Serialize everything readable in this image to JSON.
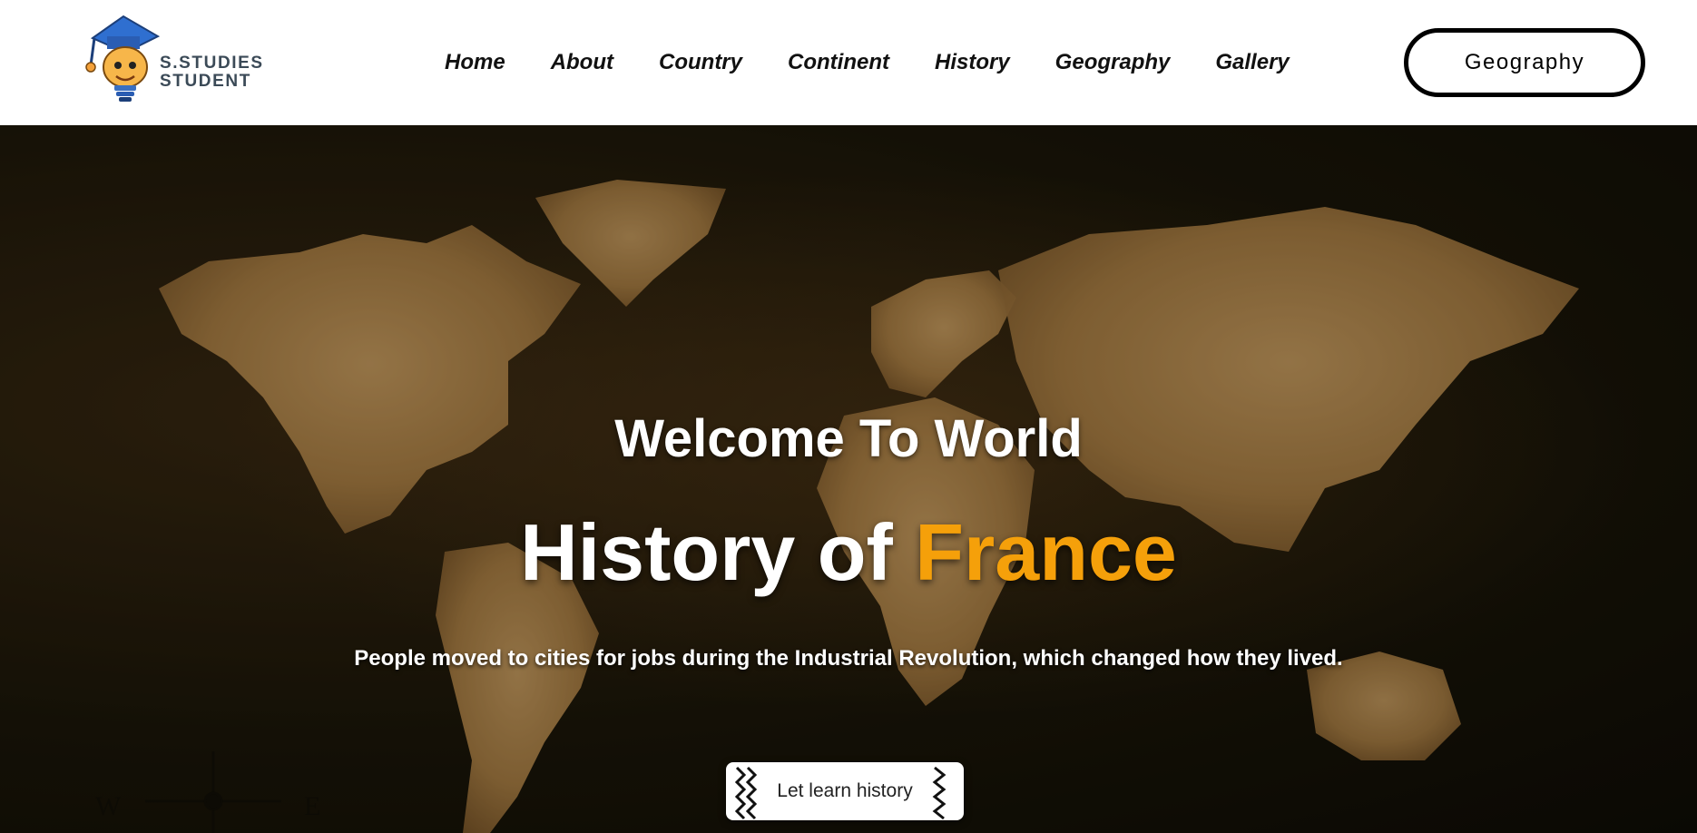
{
  "logo": {
    "line1": "S.STUDIES",
    "line2": "STUDENT"
  },
  "nav": {
    "items": [
      "Home",
      "About",
      "Country",
      "Continent",
      "History",
      "Geography",
      "Gallery"
    ]
  },
  "header_button": {
    "label": "Geography"
  },
  "hero": {
    "welcome": "Welcome To World",
    "title_main": "History of ",
    "title_accent": "France",
    "subtitle": "People moved to cities for jobs during the Industrial Revolution, which changed how they lived.",
    "cta_label": "Let learn history"
  },
  "colors": {
    "accent": "#f5a00a",
    "header_bg": "#ffffff",
    "map_land": "#b98a4a",
    "hero_bg": "#1c1709"
  },
  "icons": [
    "student-mascot-logo-icon",
    "world-map-background",
    "braid-decoration-icon"
  ]
}
